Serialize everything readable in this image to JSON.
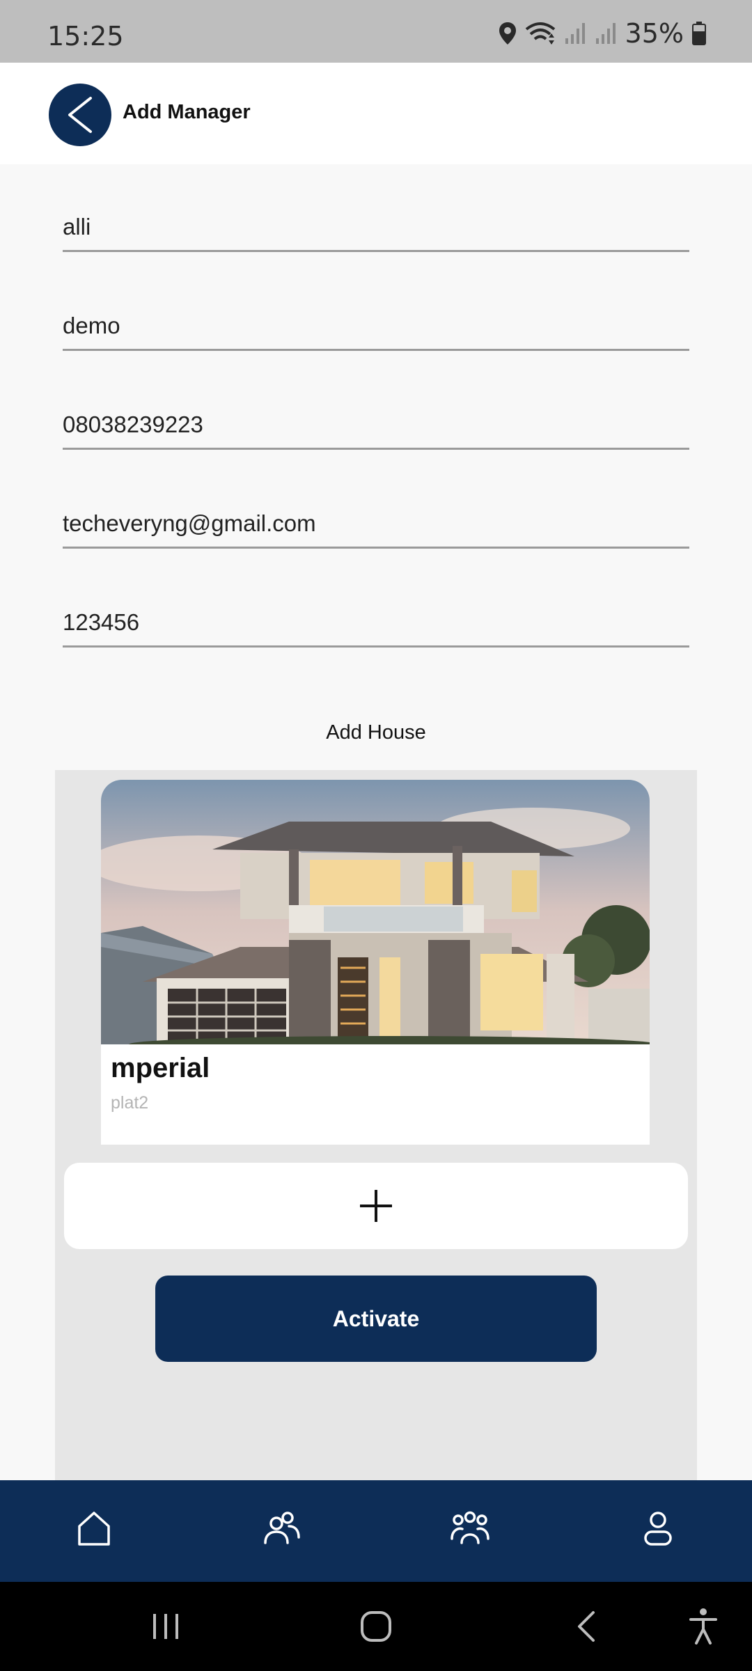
{
  "status_bar": {
    "time": "15:25",
    "battery_text": "35%"
  },
  "header": {
    "title": "Add Manager",
    "back_icon": "chevron-left-icon"
  },
  "form": {
    "first_name": "alli",
    "last_name": "demo",
    "phone": "08038239223",
    "email": "techeveryng@gmail.com",
    "password": "123456"
  },
  "houses": {
    "section_label": "Add House",
    "items": [
      {
        "name": "mperial",
        "subtitle": "plat2"
      }
    ],
    "add_icon": "plus-icon",
    "activate_label": "Activate"
  },
  "bottom_nav": [
    "home-icon",
    "users-icon",
    "group-icon",
    "profile-icon"
  ],
  "system_nav": [
    "recents-icon",
    "home-button-icon",
    "back-icon",
    "accessibility-icon"
  ],
  "colors": {
    "primary": "#0d2d57",
    "panel": "#e6e6e6",
    "background": "#f8f8f8"
  }
}
